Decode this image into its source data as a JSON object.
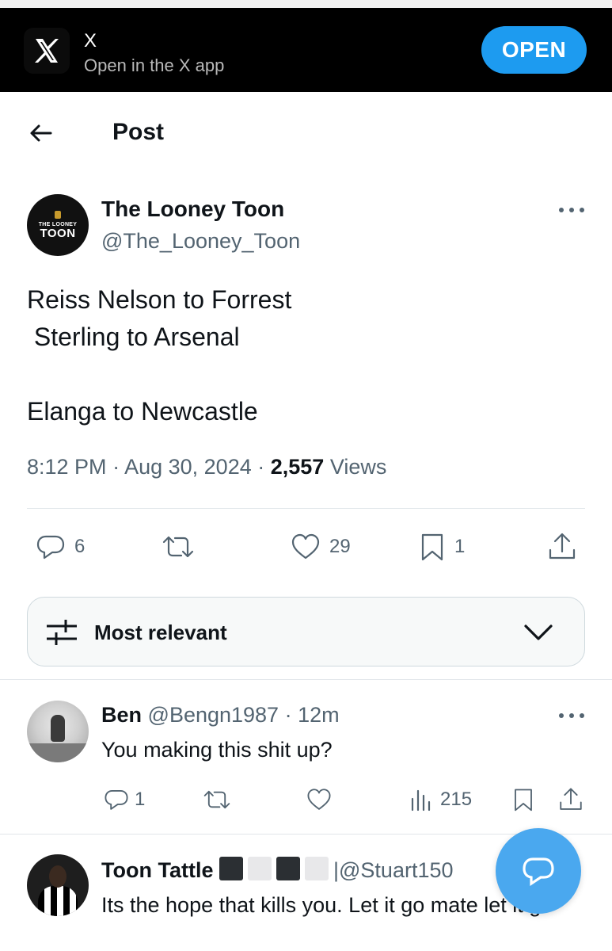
{
  "banner": {
    "app_name": "X",
    "subtitle": "Open in the X app",
    "open_label": "OPEN",
    "logo_icon": "x-logo-icon"
  },
  "header": {
    "title": "Post",
    "back_icon": "arrow-left-icon"
  },
  "post": {
    "avatar_text_small": "THE LOONEY",
    "avatar_text_big": "TOON",
    "display_name": "The Looney Toon",
    "handle": "@The_Looney_Toon",
    "text": "Reiss Nelson to Forrest\n Sterling to Arsenal\n\nElanga to Newcastle",
    "time": "8:12 PM",
    "date": "Aug 30, 2024",
    "views_count": "2,557",
    "views_label": "Views",
    "separator": " · ",
    "actions": {
      "replies": "6",
      "reposts": "",
      "likes": "29",
      "bookmarks": "1"
    }
  },
  "sort": {
    "label": "Most relevant"
  },
  "replies": [
    {
      "display_name": "Ben",
      "handle": "@Bengn1987",
      "time": "12m",
      "text": "You making this shit up?",
      "replies": "1",
      "views": "215"
    },
    {
      "display_name": "Toon Tattle",
      "handle": "@Stuart150",
      "text": "Its the hope that kills you. Let it go mate let it go"
    }
  ],
  "colors": {
    "accent": "#1d9bf0",
    "fab": "#4aa8ef",
    "muted": "#536471",
    "text": "#0f1419",
    "banner_bg": "#000000"
  }
}
